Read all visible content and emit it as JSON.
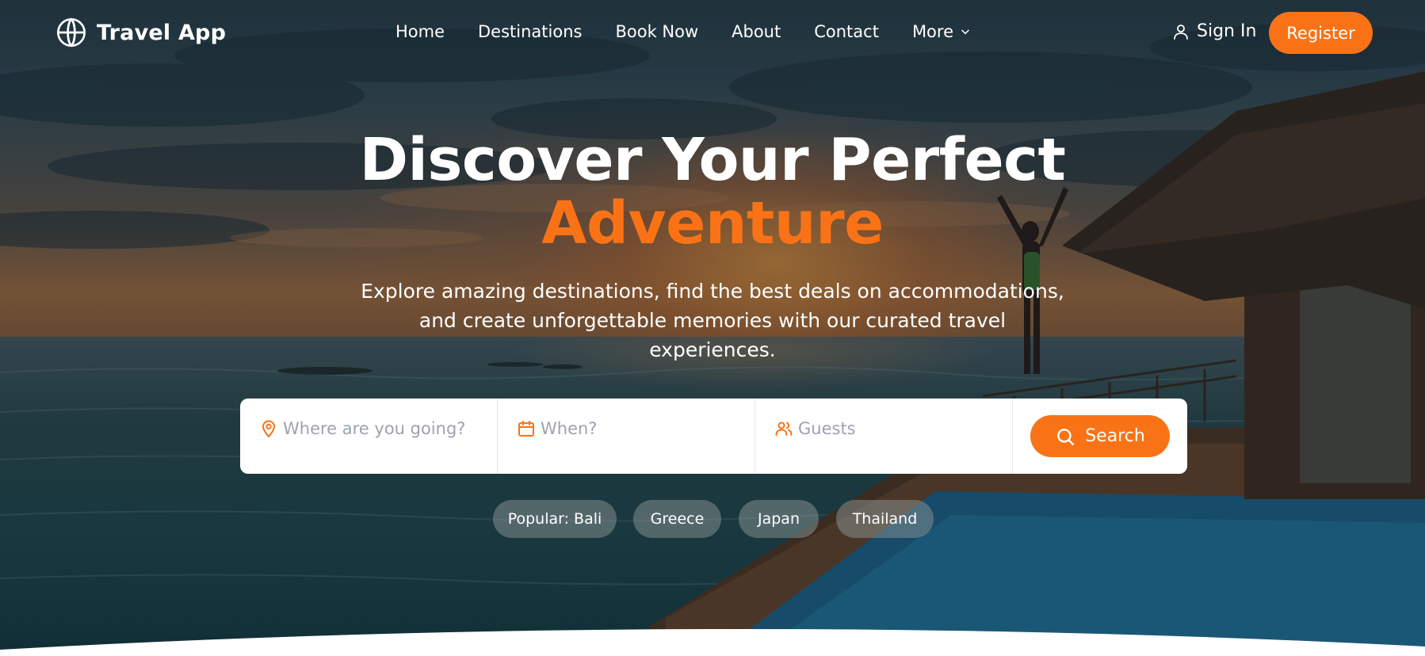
{
  "brand": {
    "name": "Travel App",
    "icon": "globe-icon"
  },
  "nav": {
    "links": [
      "Home",
      "Destinations",
      "Book Now",
      "About",
      "Contact"
    ],
    "more_label": "More",
    "signin_label": "Sign In",
    "register_label": "Register"
  },
  "hero": {
    "title_line1": "Discover Your Perfect",
    "title_line2": "Adventure",
    "subtitle": "Explore amazing destinations, find the best deals on accommodations, and create unforgettable memories with our curated travel experiences."
  },
  "search": {
    "destination_placeholder": "Where are you going?",
    "date_placeholder": "When?",
    "guests_placeholder": "Guests",
    "button_label": "Search"
  },
  "popular": [
    "Popular: Bali",
    "Greece",
    "Japan",
    "Thailand"
  ],
  "colors": {
    "accent": "#f97316",
    "text": "#ffffff",
    "placeholder": "#9ca3af"
  }
}
